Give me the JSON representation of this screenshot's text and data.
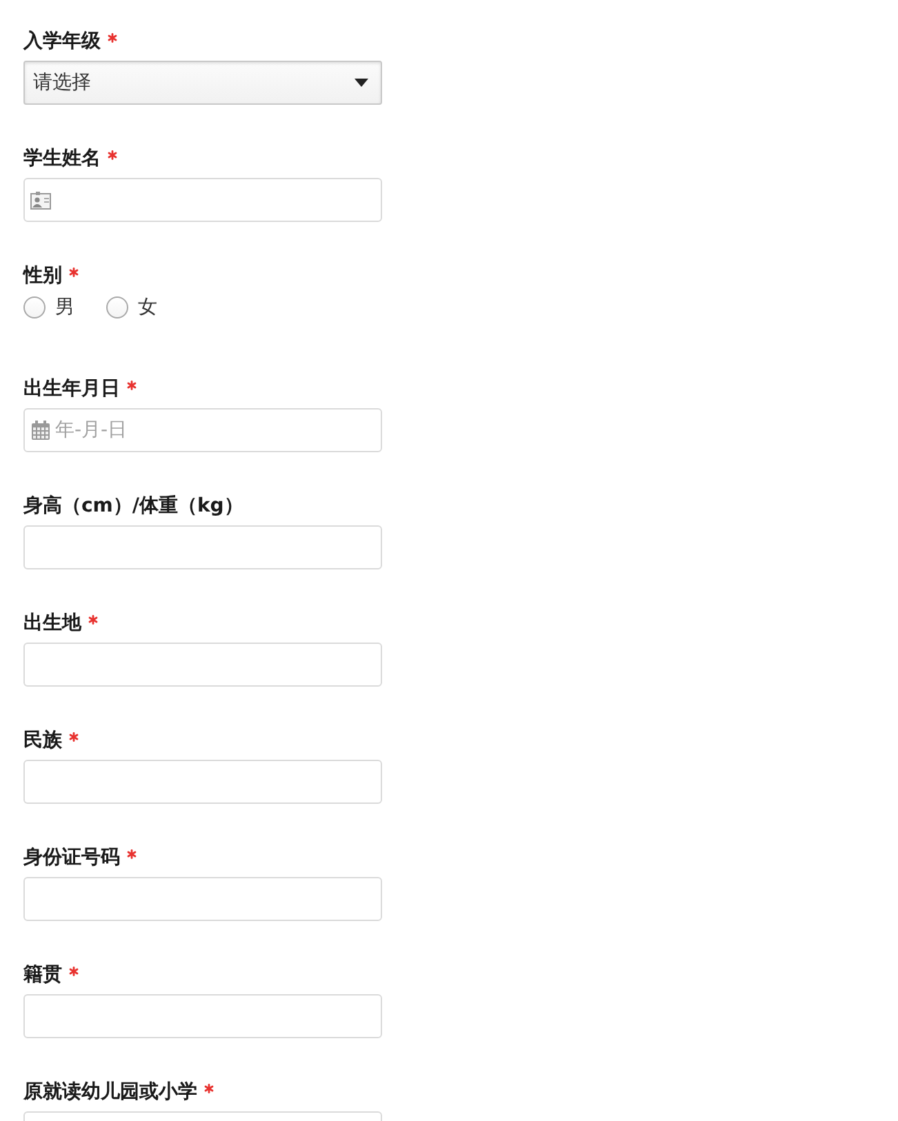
{
  "form": {
    "fields": [
      {
        "kind": "select",
        "label": "入学年级",
        "required": true,
        "value": "请选择"
      },
      {
        "kind": "name",
        "label": "学生姓名",
        "required": true
      },
      {
        "kind": "radio",
        "label": "性别",
        "required": true,
        "options": [
          {
            "label": "男",
            "selected": false
          },
          {
            "label": "女",
            "selected": false
          }
        ]
      },
      {
        "kind": "date",
        "label": "出生年月日",
        "required": true,
        "placeholder": "年-月-日"
      },
      {
        "kind": "text",
        "label": "身高（cm）/体重（kg）",
        "required": false
      },
      {
        "kind": "text",
        "label": "出生地",
        "required": true
      },
      {
        "kind": "text",
        "label": "民族",
        "required": true
      },
      {
        "kind": "text",
        "label": "身份证号码",
        "required": true
      },
      {
        "kind": "text",
        "label": "籍贯",
        "required": true
      },
      {
        "kind": "text",
        "label": "原就读幼儿园或小学",
        "required": true
      }
    ]
  }
}
